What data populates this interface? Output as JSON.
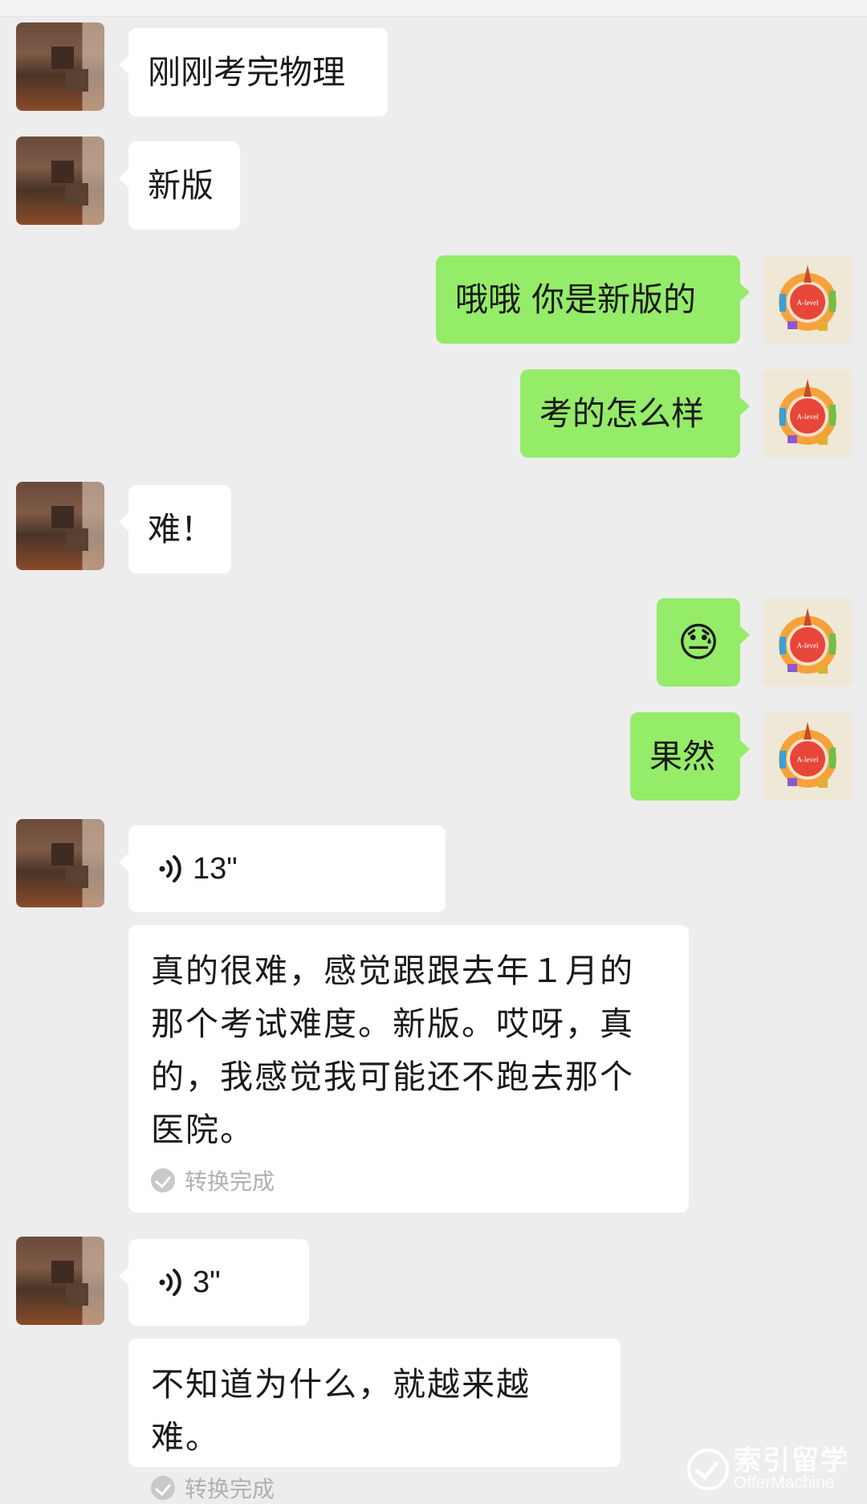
{
  "messages": [
    {
      "side": "left",
      "type": "text",
      "text": "刚刚考完物理"
    },
    {
      "side": "left",
      "type": "text",
      "text": "新版"
    },
    {
      "side": "right",
      "type": "text",
      "text": "哦哦 你是新版的"
    },
    {
      "side": "right",
      "type": "text",
      "text": "考的怎么样"
    },
    {
      "side": "left",
      "type": "text",
      "text": "难！"
    },
    {
      "side": "right",
      "type": "emoji",
      "text": "😓",
      "emoji_name": "downcast-sweat-emoji"
    },
    {
      "side": "right",
      "type": "text",
      "text": "果然"
    },
    {
      "side": "left",
      "type": "voice",
      "duration": "13\"",
      "transcript": "真的很难，感觉跟跟去年１月的那个考试难度。新版。哎呀，真的，我感觉我可能还不跑去那个医院。",
      "status": "转换完成"
    },
    {
      "side": "left",
      "type": "voice",
      "duration": "3\"",
      "transcript": "不知道为什么，就越来越难。",
      "status": "转换完成"
    }
  ],
  "avatar_right_label": "A-level",
  "watermark": {
    "cn": "索引留学",
    "en": "OfferMachine"
  },
  "colors": {
    "background": "#ededed",
    "left_bubble": "#ffffff",
    "right_bubble": "#95ec69",
    "status_text": "#b0b0b0"
  }
}
